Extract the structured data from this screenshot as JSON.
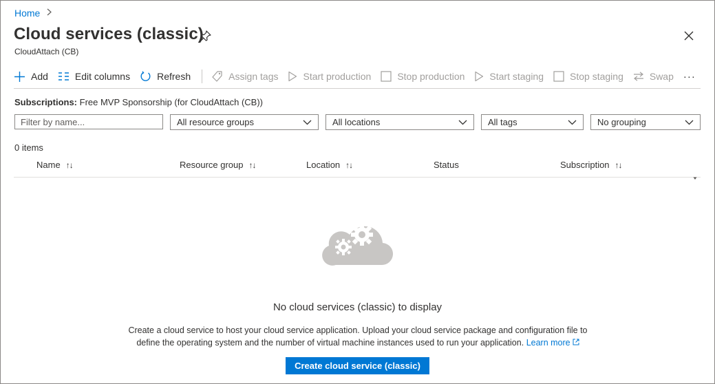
{
  "breadcrumb": {
    "home": "Home"
  },
  "header": {
    "title": "Cloud services (classic)",
    "subtitle": "CloudAttach (CB)"
  },
  "toolbar": {
    "add": "Add",
    "edit_columns": "Edit columns",
    "refresh": "Refresh",
    "assign_tags": "Assign tags",
    "start_production": "Start production",
    "stop_production": "Stop production",
    "start_staging": "Start staging",
    "stop_staging": "Stop staging",
    "swap": "Swap",
    "more": "···"
  },
  "subscriptions": {
    "label": "Subscriptions:",
    "value": "Free MVP Sponsorship (for CloudAttach (CB))"
  },
  "filters": {
    "name_placeholder": "Filter by name...",
    "resource_groups": "All resource groups",
    "locations": "All locations",
    "tags": "All tags",
    "grouping": "No grouping"
  },
  "items_count": "0 items",
  "table": {
    "columns": [
      "Name",
      "Resource group",
      "Location",
      "Status",
      "Subscription"
    ],
    "sort_glyph": "↑↓"
  },
  "empty_state": {
    "title": "No cloud services (classic) to display",
    "description_line1": "Create a cloud service to host your cloud service application. Upload your cloud service package and configuration file to",
    "description_line2": "define the operating system and the number of virtual machine instances used to run your application.",
    "learn_more": "Learn more",
    "create_button": "Create cloud service (classic)"
  },
  "colors": {
    "accent": "#0078d4",
    "disabled": "#a19f9d",
    "text": "#323130",
    "icon_gray": "#c8c6c4"
  }
}
